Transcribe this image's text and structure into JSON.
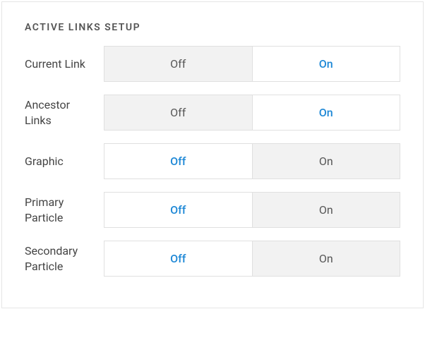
{
  "section_title": "ACTIVE LINKS SETUP",
  "toggle_labels": {
    "off": "Off",
    "on": "On"
  },
  "rows": [
    {
      "label": "Current Link",
      "value": "on"
    },
    {
      "label": "Ancestor Links",
      "value": "on"
    },
    {
      "label": "Graphic",
      "value": "off"
    },
    {
      "label": "Primary Particle",
      "value": "off"
    },
    {
      "label": "Secondary Particle",
      "value": "off"
    }
  ],
  "colors": {
    "accent": "#1e88d6",
    "inactive_bg": "#f2f2f2",
    "border": "#e0e0e0",
    "text": "#444"
  }
}
